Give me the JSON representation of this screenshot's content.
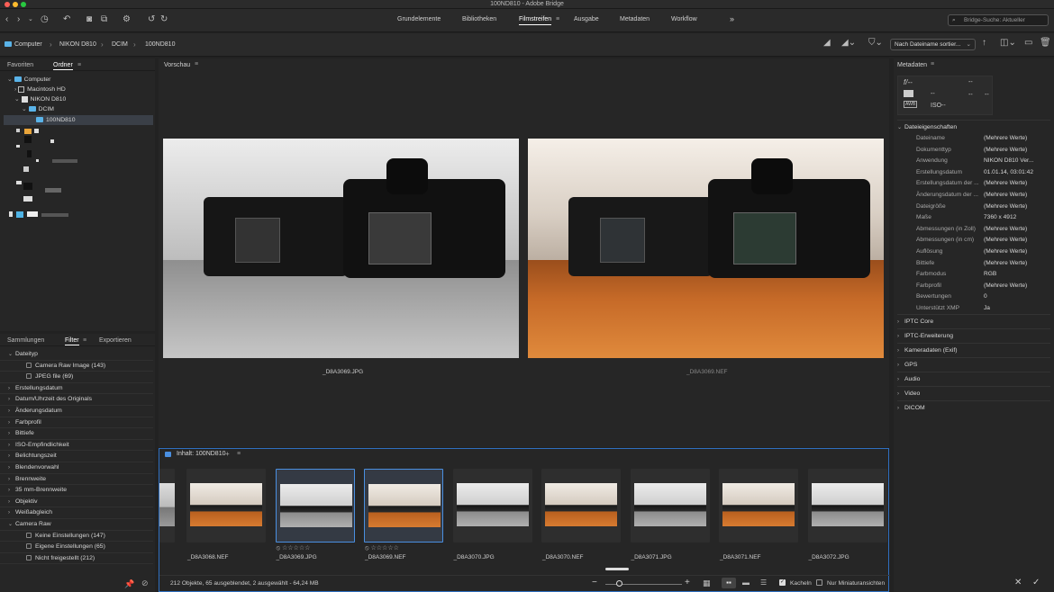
{
  "window": {
    "title": "100ND810 - Adobe Bridge"
  },
  "toolbar": {
    "workspaces": [
      "Grundelemente",
      "Bibliotheken",
      "Filmstreifen",
      "Ausgabe",
      "Metadaten",
      "Workflow"
    ],
    "active_workspace": "Filmstreifen",
    "more": "»",
    "search_placeholder": "Bridge-Suche: Aktueller"
  },
  "path": {
    "crumbs": [
      "Computer",
      "NIKON D810",
      "DCIM",
      "100ND810"
    ],
    "sort_label": "Nach Dateiname sortier..."
  },
  "left_top": {
    "tabs": [
      "Favoriten",
      "Ordner"
    ],
    "active_tab": "Ordner",
    "tree": [
      {
        "label": "Computer",
        "level": 0,
        "expanded": true
      },
      {
        "label": "Macintosh HD",
        "level": 1,
        "expanded": false
      },
      {
        "label": "NIKON D810",
        "level": 1,
        "expanded": true
      },
      {
        "label": "DCIM",
        "level": 2,
        "expanded": true
      },
      {
        "label": "100ND810",
        "level": 3,
        "expanded": false,
        "selected": true
      }
    ]
  },
  "left_bottom": {
    "tabs": [
      "Sammlungen",
      "Filter",
      "Exportieren"
    ],
    "active_tab": "Filter",
    "filters": [
      {
        "label": "Dateityp",
        "expanded": true,
        "indent": false
      },
      {
        "label": "Camera Raw Image (143)",
        "indent": true,
        "checkbox": true
      },
      {
        "label": "JPEG file  (69)",
        "indent": true,
        "checkbox": true
      },
      {
        "label": "Erstellungsdatum",
        "expanded": false,
        "indent": false
      },
      {
        "label": "Datum/Uhrzeit des Originals",
        "expanded": false,
        "indent": false
      },
      {
        "label": "Änderungsdatum",
        "expanded": false,
        "indent": false
      },
      {
        "label": "Farbprofil",
        "expanded": false,
        "indent": false
      },
      {
        "label": "Bittiefe",
        "expanded": false,
        "indent": false
      },
      {
        "label": "ISO-Empfindlichkeit",
        "expanded": false,
        "indent": false
      },
      {
        "label": "Belichtungszeit",
        "expanded": false,
        "indent": false
      },
      {
        "label": "Blendenvorwahl",
        "expanded": false,
        "indent": false
      },
      {
        "label": "Brennweite",
        "expanded": false,
        "indent": false
      },
      {
        "label": "35 mm-Brennweite",
        "expanded": false,
        "indent": false
      },
      {
        "label": "Objektiv",
        "expanded": false,
        "indent": false
      },
      {
        "label": "Weißabgleich",
        "expanded": false,
        "indent": false
      },
      {
        "label": "Camera Raw",
        "expanded": true,
        "indent": false
      },
      {
        "label": "Keine Einstellungen  (147)",
        "indent": true,
        "checkbox": true
      },
      {
        "label": "Eigene Einstellungen  (65)",
        "indent": true,
        "checkbox": true
      },
      {
        "label": "Nicht freigestellt  (212)",
        "indent": true,
        "checkbox": true
      }
    ]
  },
  "preview": {
    "title": "Vorschau",
    "left_caption": "_D8A3069.JPG",
    "right_caption": "_D8A3069.NEF"
  },
  "content": {
    "title": "Inhalt: 100ND810",
    "thumbs": [
      {
        "label": "_D8A3068.NEF",
        "color": true,
        "selected": false,
        "stars": false
      },
      {
        "label": "_D8A3069.JPG",
        "color": false,
        "selected": true,
        "stars": true
      },
      {
        "label": "_D8A3069.NEF",
        "color": true,
        "selected": true,
        "stars": true
      },
      {
        "label": "_D8A3070.JPG",
        "color": false,
        "selected": false,
        "stars": false
      },
      {
        "label": "_D8A3070.NEF",
        "color": true,
        "selected": false,
        "stars": false
      },
      {
        "label": "_D8A3071.JPG",
        "color": false,
        "selected": false,
        "stars": false
      },
      {
        "label": "_D8A3071.NEF",
        "color": true,
        "selected": false,
        "stars": false
      },
      {
        "label": "_D8A3072.JPG",
        "color": false,
        "selected": false,
        "stars": false
      }
    ],
    "stars_text": "⦸ ☆☆☆☆☆",
    "status": "212 Objekte, 65 ausgeblendet, 2 ausgewählt - 64,24 MB",
    "kacheln_label": "Kacheln",
    "miniatur_label": "Nur Miniaturansichten"
  },
  "meta": {
    "title": "Metadaten",
    "placard": {
      "f": "f/--",
      "dash": "--",
      "iso": "ISO--"
    },
    "section": "Dateieigenschaften",
    "rows": [
      [
        "Dateiname",
        "(Mehrere Werte)"
      ],
      [
        "Dokumenttyp",
        "(Mehrere Werte)"
      ],
      [
        "Anwendung",
        "NIKON D810 Ver..."
      ],
      [
        "Erstellungsdatum",
        "01.01.14, 03:01:42"
      ],
      [
        "Erstellungsdatum der ...",
        "(Mehrere Werte)"
      ],
      [
        "Änderungsdatum der ...",
        "(Mehrere Werte)"
      ],
      [
        "Dateigröße",
        "(Mehrere Werte)"
      ],
      [
        "Maße",
        "7360 x 4912"
      ],
      [
        "Abmessungen (in Zoll)",
        "(Mehrere Werte)"
      ],
      [
        "Abmessungen (in cm)",
        "(Mehrere Werte)"
      ],
      [
        "Auflösung",
        "(Mehrere Werte)"
      ],
      [
        "Bittiefe",
        "(Mehrere Werte)"
      ],
      [
        "Farbmodus",
        "RGB"
      ],
      [
        "Farbprofil",
        "(Mehrere Werte)"
      ],
      [
        "Bewertungen",
        "0"
      ],
      [
        "Unterstützt XMP",
        "Ja"
      ]
    ],
    "collapsed": [
      "IPTC Core",
      "IPTC-Erweiterung",
      "Kameradaten (Exif)",
      "GPS",
      "Audio",
      "Video",
      "DICOM"
    ]
  },
  "colors": {
    "accent": "#2f6fc0",
    "folder": "#5ab3e8",
    "panel": "#262626",
    "bg": "#1e1e1e"
  }
}
